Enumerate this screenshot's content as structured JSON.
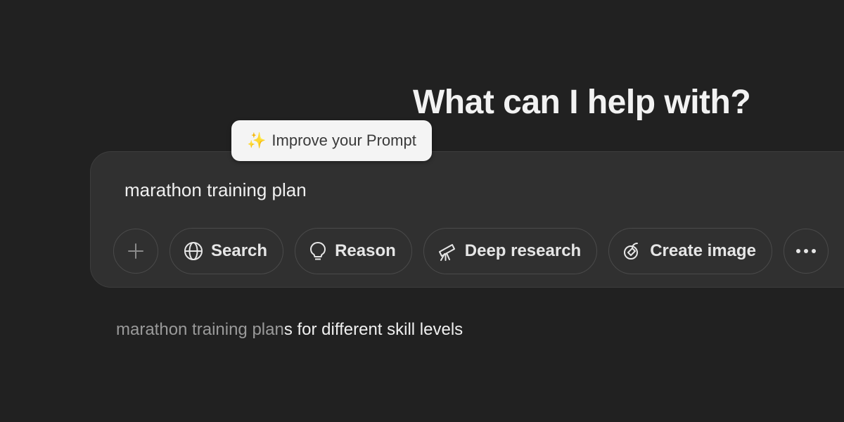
{
  "headline": "What can I help with?",
  "tooltip": {
    "icon": "sparkles-icon",
    "label": "Improve your Prompt"
  },
  "composer": {
    "input_value": "marathon training plan",
    "buttons": [
      {
        "icon": "plus-icon",
        "label": ""
      },
      {
        "icon": "globe-icon",
        "label": "Search"
      },
      {
        "icon": "lightbulb-icon",
        "label": "Reason"
      },
      {
        "icon": "telescope-icon",
        "label": "Deep research"
      },
      {
        "icon": "paint-brush-icon",
        "label": "Create image"
      },
      {
        "icon": "more-icon",
        "label": ""
      }
    ]
  },
  "suggestion": {
    "typed": "marathon training plan",
    "completion": "s for different skill levels"
  }
}
